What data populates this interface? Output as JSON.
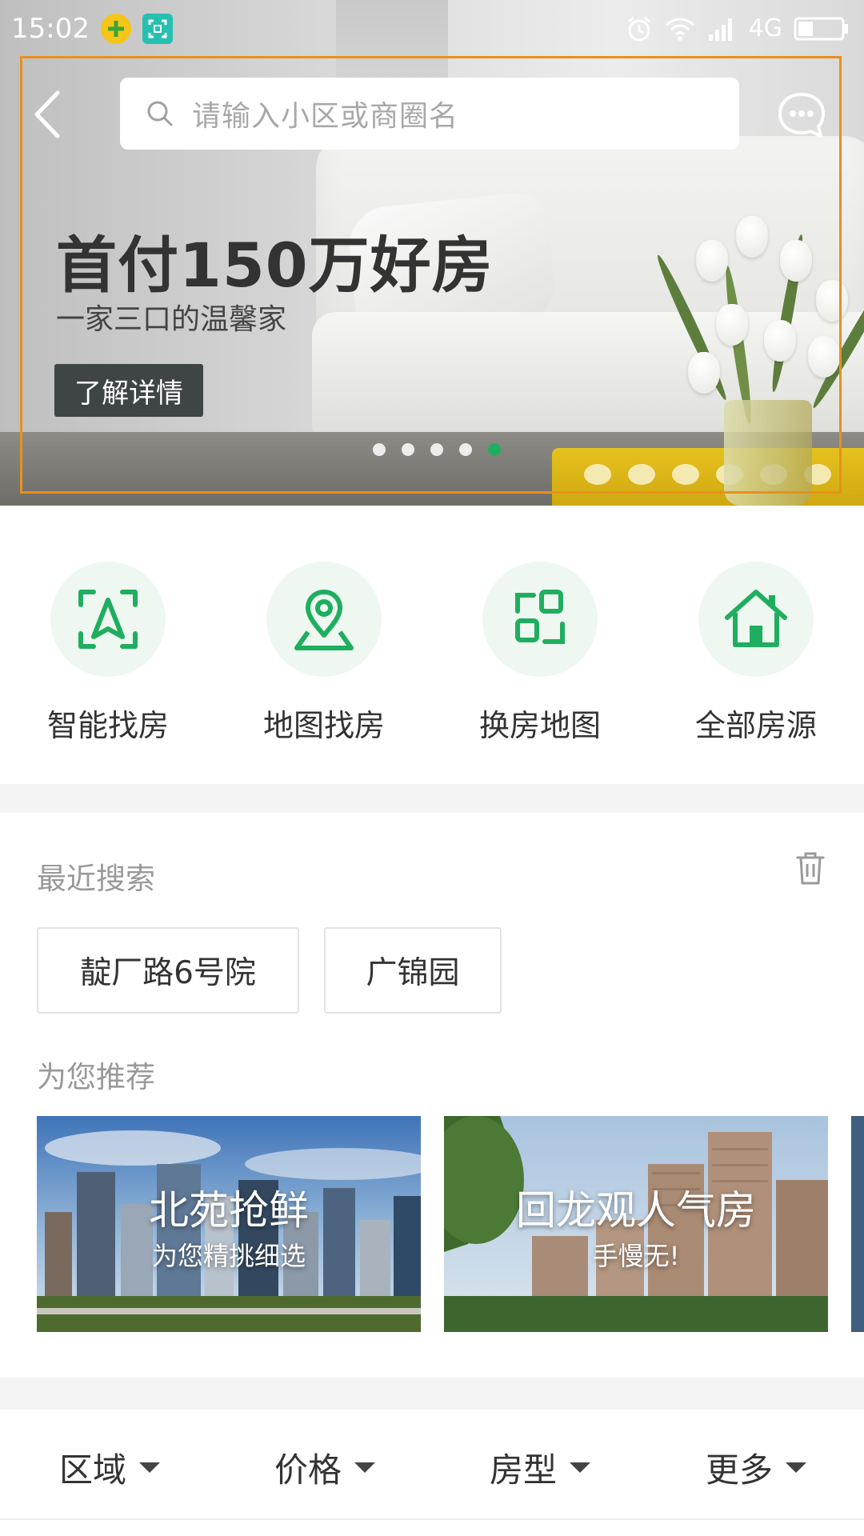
{
  "status_bar": {
    "time": "15:02",
    "network": "4G"
  },
  "search": {
    "placeholder": "请输入小区或商圈名"
  },
  "banner": {
    "title": "首付150万好房",
    "subtitle": "一家三口的温馨家",
    "cta": "了解详情",
    "dots_total": 5,
    "dots_active_index": 4
  },
  "quick_entries": [
    {
      "label": "智能找房",
      "icon": "smart-locate-icon"
    },
    {
      "label": "地图找房",
      "icon": "map-pin-icon"
    },
    {
      "label": "换房地图",
      "icon": "swap-grid-icon"
    },
    {
      "label": "全部房源",
      "icon": "house-icon"
    }
  ],
  "recent_search": {
    "title": "最近搜索",
    "chips": [
      "靛厂路6号院",
      "广锦园"
    ]
  },
  "recommend": {
    "title": "为您推荐",
    "cards": [
      {
        "title": "北苑抢鲜",
        "subtitle": "为您精挑细选"
      },
      {
        "title": "回龙观人气房",
        "subtitle": "手慢无!"
      }
    ]
  },
  "filters": [
    {
      "label": "区域"
    },
    {
      "label": "价格"
    },
    {
      "label": "房型"
    },
    {
      "label": "更多"
    }
  ],
  "colors": {
    "accent_green": "#1fae5f",
    "icon_bg": "#eef8f1",
    "highlight_outline": "#e8901d"
  }
}
